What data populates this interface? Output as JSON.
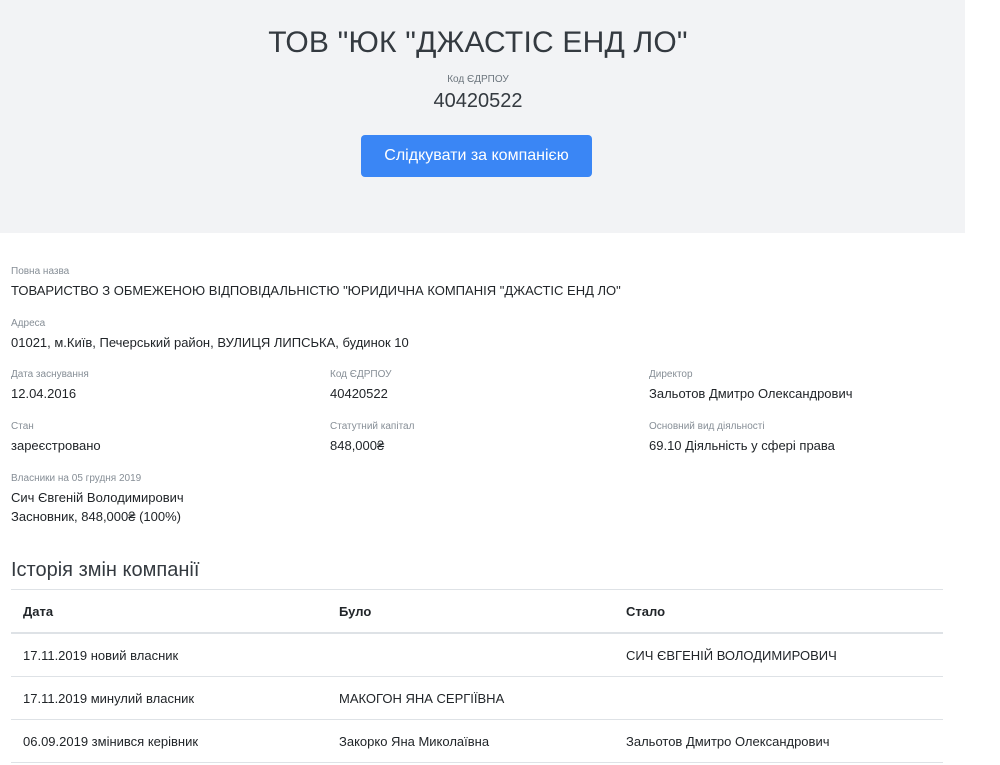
{
  "company": {
    "short_name": "ТОВ \"ЮК \"ДЖАСТІС ЕНД ЛО\"",
    "code_label": "Код ЄДРПОУ",
    "code": "40420522",
    "follow_button": "Слідкувати за компанією"
  },
  "details": {
    "full_name_label": "Повна назва",
    "full_name": "ТОВАРИСТВО З ОБМЕЖЕНОЮ ВІДПОВІДАЛЬНІСТЮ \"ЮРИДИЧНА КОМПАНІЯ \"ДЖАСТІС ЕНД ЛО\"",
    "address_label": "Адреса",
    "address": "01021, м.Київ, Печерський район, ВУЛИЦЯ ЛИПСЬКА, будинок 10",
    "founded_label": "Дата заснування",
    "founded": "12.04.2016",
    "code_label": "Код ЄДРПОУ",
    "code": "40420522",
    "director_label": "Директор",
    "director": "Зальотов Дмитро Олександрович",
    "status_label": "Стан",
    "status": "зареєстровано",
    "capital_label": "Статутний капітал",
    "capital": "848,000₴",
    "activity_label": "Основний вид діяльності",
    "activity": "69.10 Діяльність у сфері права",
    "owners_label": "Власники на 05 грудня 2019",
    "owner_name": "Сич Євгеній Володимирович",
    "owner_share": "Засновник, 848,000₴ (100%)"
  },
  "history": {
    "title": "Історія змін компанії",
    "headers": {
      "date": "Дата",
      "was": "Було",
      "became": "Стало"
    },
    "rows": [
      {
        "date": "17.11.2019 новий власник",
        "was": "",
        "became": "СИЧ ЄВГЕНІЙ ВОЛОДИМИРОВИЧ"
      },
      {
        "date": "17.11.2019 минулий власник",
        "was": "МАКОГОН ЯНА СЕРГІЇВНА",
        "became": ""
      },
      {
        "date": "06.09.2019 змінився керівник",
        "was": "Закорко Яна Миколаївна",
        "became": "Зальотов Дмитро Олександрович"
      }
    ]
  },
  "colors": {
    "hero_background": "#f2f3f5",
    "button_background": "#3a86f5",
    "button_text": "#ffffff",
    "label_text": "#868e96"
  }
}
